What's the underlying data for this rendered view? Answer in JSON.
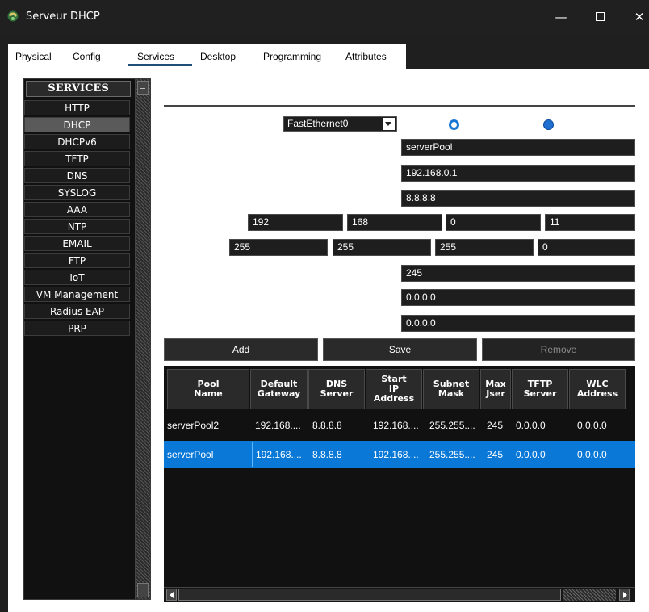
{
  "window": {
    "title": "Serveur DHCP",
    "minimize": "—",
    "close": "✕"
  },
  "tabs": [
    "Physical",
    "Config",
    "Services",
    "Desktop",
    "Programming",
    "Attributes"
  ],
  "services": {
    "title": "SERVICES",
    "items": [
      "HTTP",
      "DHCP",
      "DHCPv6",
      "TFTP",
      "DNS",
      "SYSLOG",
      "AAA",
      "NTP",
      "EMAIL",
      "FTP",
      "IoT",
      "VM Management",
      "Radius EAP",
      "PRP"
    ],
    "selected": "DHCP"
  },
  "dhcp": {
    "interface": "FastEthernet0",
    "pool_name": "serverPool",
    "default_gateway": "192.168.0.1",
    "dns_server": "8.8.8.8",
    "start_ip": [
      "192",
      "168",
      "0",
      "11"
    ],
    "subnet_mask": [
      "255",
      "255",
      "255",
      "0"
    ],
    "max_users": "245",
    "tftp_server": "0.0.0.0",
    "wlc_address": "0.0.0.0"
  },
  "buttons": {
    "add": "Add",
    "save": "Save",
    "remove": "Remove"
  },
  "table": {
    "headers": [
      "Pool\nName",
      "Default\nGateway",
      "DNS\nServer",
      "Start\nIP\nAddress",
      "Subnet\nMask",
      "Max\nJser",
      "TFTP\nServer",
      "WLC\nAddress"
    ],
    "rows": [
      [
        "serverPool2",
        "192.168....",
        "8.8.8.8",
        "192.168....",
        "255.255....",
        "245",
        "0.0.0.0",
        "0.0.0.0"
      ],
      [
        "serverPool",
        "192.168....",
        "8.8.8.8",
        "192.168....",
        "255.255....",
        "245",
        "0.0.0.0",
        "0.0.0.0"
      ]
    ],
    "selected_row": 1
  },
  "colors": {
    "selection": "#0a78d7",
    "radio": "#1976d2"
  }
}
